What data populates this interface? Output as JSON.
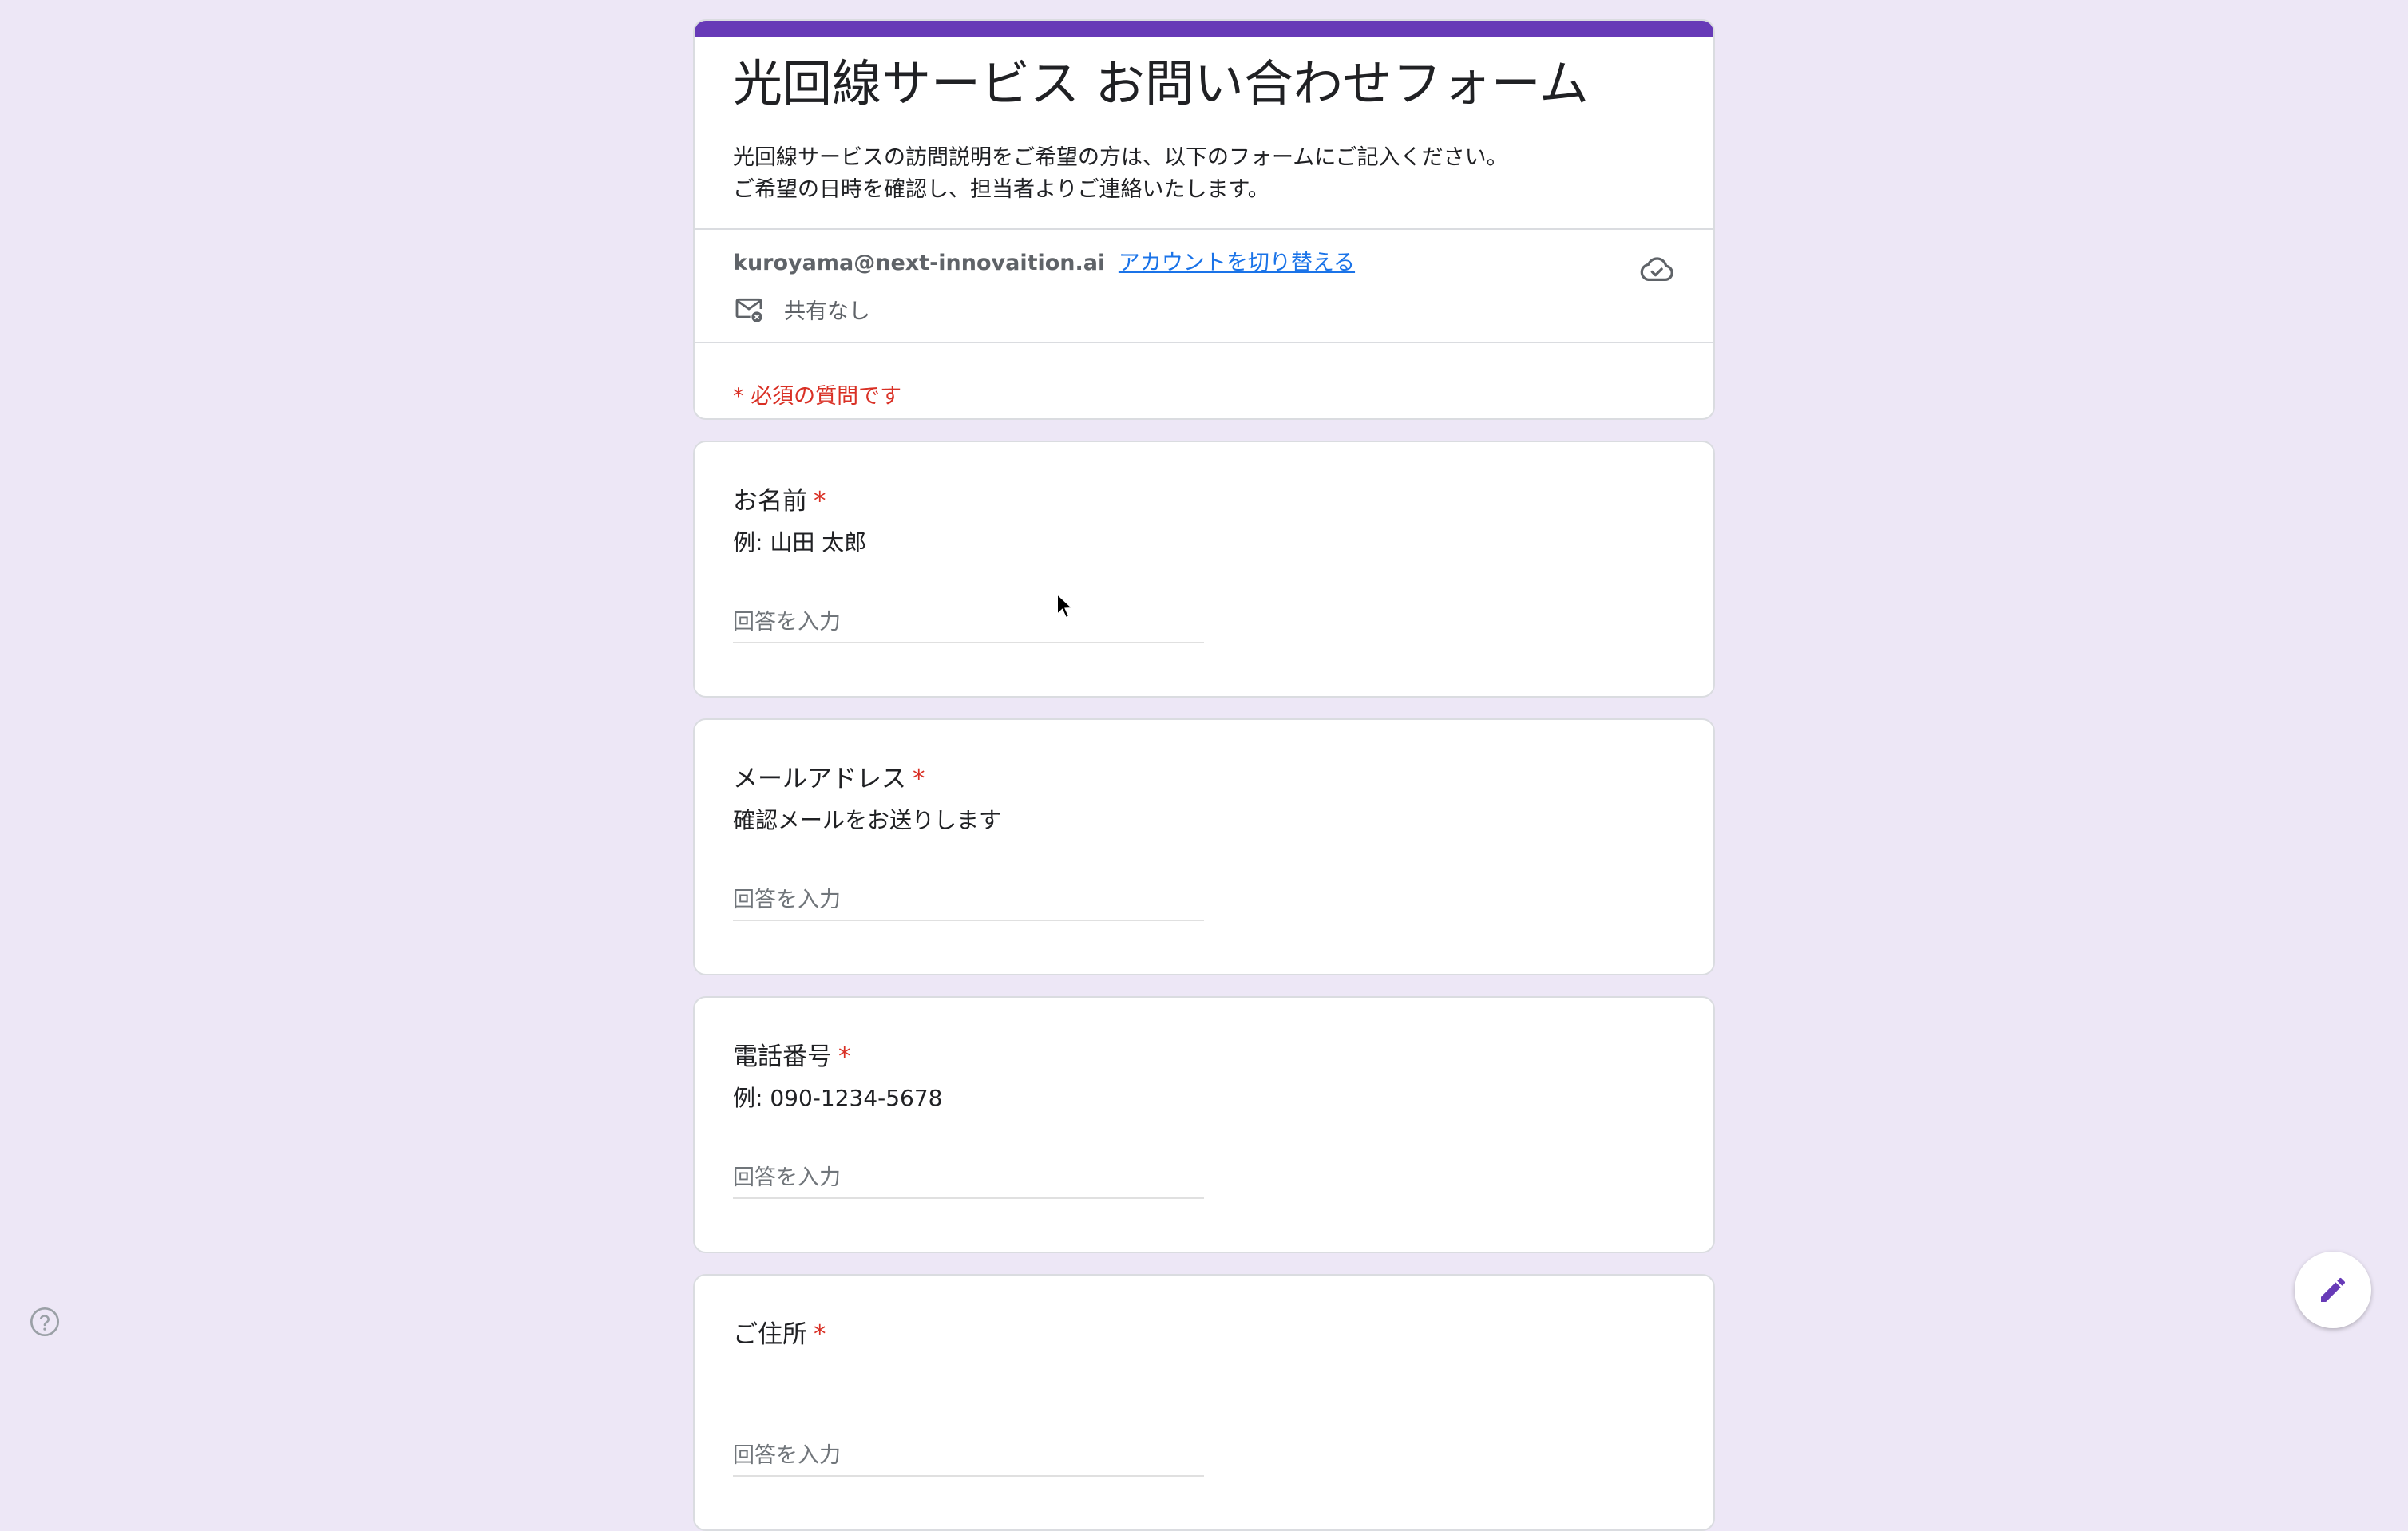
{
  "form": {
    "title": "光回線サービス お問い合わせフォーム",
    "description": "光回線サービスの訪問説明をご希望の方は、以下のフォームにご記入ください。\nご希望の日時を確認し、担当者よりご連絡いたします。",
    "account_email": "kuroyama@next-innovaition.ai",
    "switch_account_label": "アカウントを切り替える",
    "share_status": "共有なし",
    "required_note": "* 必須の質問です",
    "accent_color": "#673ab7",
    "background_color": "#ede7f6",
    "required_color": "#d93025",
    "link_color": "#1a73e8"
  },
  "questions": [
    {
      "title": "お名前",
      "required_mark": "*",
      "help": "例: 山田 太郎",
      "placeholder": "回答を入力"
    },
    {
      "title": "メールアドレス",
      "required_mark": "*",
      "help": "確認メールをお送りします",
      "placeholder": "回答を入力"
    },
    {
      "title": "電話番号",
      "required_mark": "*",
      "help": "例: 090-1234-5678",
      "placeholder": "回答を入力"
    },
    {
      "title": "ご住所",
      "required_mark": "*",
      "help": "",
      "placeholder": "回答を入力"
    }
  ],
  "icons": {
    "cloud": "cloud-check-icon",
    "mail": "mail-off-icon",
    "help": "help-circle-icon",
    "edit": "pencil-icon",
    "cursor": "mouse-pointer-icon"
  }
}
